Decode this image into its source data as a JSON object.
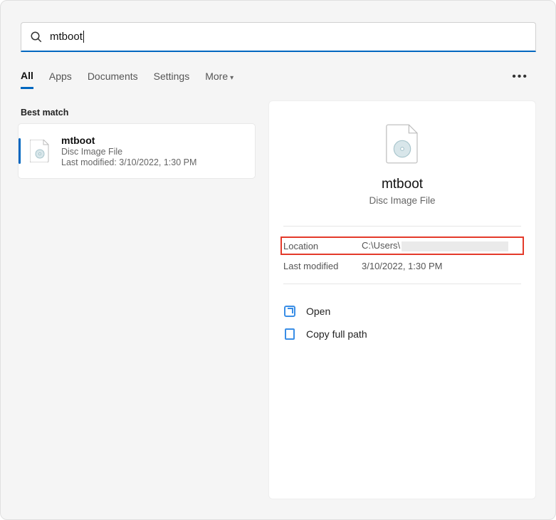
{
  "search": {
    "query": "mtboot"
  },
  "tabs": [
    {
      "label": "All",
      "active": true
    },
    {
      "label": "Apps"
    },
    {
      "label": "Documents"
    },
    {
      "label": "Settings"
    },
    {
      "label": "More"
    }
  ],
  "best_match_label": "Best match",
  "result": {
    "title": "mtboot",
    "type": "Disc Image File",
    "modified_label": "Last modified: 3/10/2022, 1:30 PM"
  },
  "preview": {
    "title": "mtboot",
    "type": "Disc Image File",
    "location_label": "Location",
    "location_value": "C:\\Users\\",
    "modified_label": "Last modified",
    "modified_value": "3/10/2022, 1:30 PM",
    "actions": {
      "open": "Open",
      "copy_path": "Copy full path"
    }
  }
}
